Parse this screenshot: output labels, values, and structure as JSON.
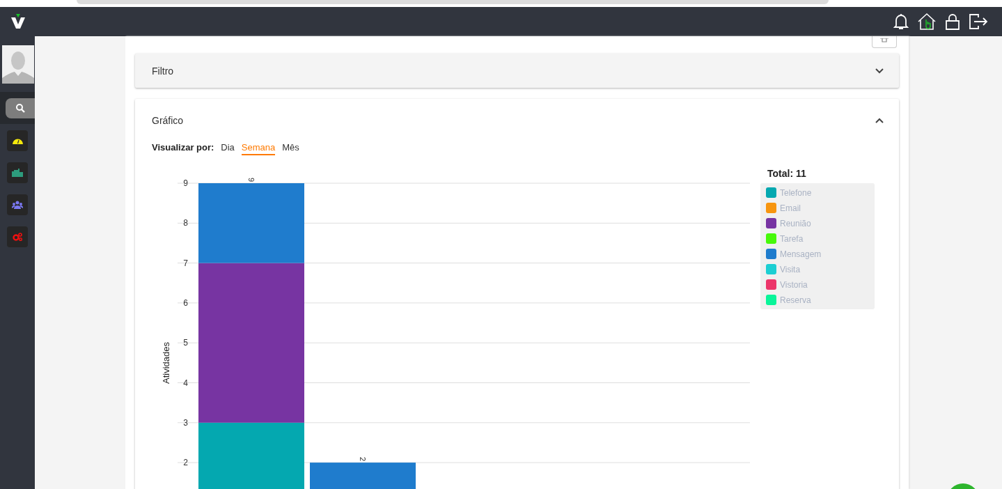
{
  "filter_panel": {
    "title": "Filtro",
    "expanded": false
  },
  "chart_panel": {
    "title": "Gráfico",
    "expanded": true,
    "view_label": "Visualizar por:",
    "view_options": [
      {
        "label": "Dia",
        "selected": false
      },
      {
        "label": "Semana",
        "selected": true
      },
      {
        "label": "Mês",
        "selected": false
      }
    ],
    "total": "Total: 11",
    "chart_data": {
      "type": "bar",
      "stacked": true,
      "ylabel": "Atividades",
      "ylim": [
        0,
        9
      ],
      "yticks": [
        2,
        3,
        4,
        5,
        6,
        7,
        8,
        9
      ],
      "grid": true,
      "annotations": [
        {
          "y": 9,
          "text": "9"
        },
        {
          "y": 2,
          "text": "2"
        }
      ],
      "series": [
        {
          "name": "Telefone",
          "color": "#04a8b0",
          "values": [
            3,
            0
          ]
        },
        {
          "name": "Email",
          "color": "#f7950f",
          "values": [
            0,
            0
          ]
        },
        {
          "name": "Reunião",
          "color": "#7734a2",
          "values": [
            4,
            0
          ]
        },
        {
          "name": "Tarefa",
          "color": "#47f90a",
          "values": [
            0,
            0
          ]
        },
        {
          "name": "Mensagem",
          "color": "#1f7ccd",
          "values": [
            2,
            2
          ]
        },
        {
          "name": "Visita",
          "color": "#1ccfd3",
          "values": [
            0,
            0
          ]
        },
        {
          "name": "Vistoria",
          "color": "#ec366a",
          "values": [
            0,
            0
          ]
        },
        {
          "name": "Reserva",
          "color": "#08f599",
          "values": [
            0,
            0
          ]
        }
      ]
    }
  }
}
